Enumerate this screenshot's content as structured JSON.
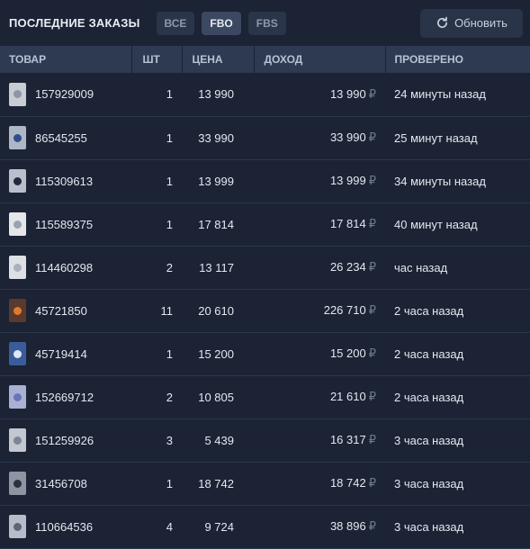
{
  "header": {
    "title": "ПОСЛЕДНИЕ ЗАКАЗЫ",
    "filters": [
      {
        "label": "ВСЕ",
        "active": false
      },
      {
        "label": "FBO",
        "active": true
      },
      {
        "label": "FBS",
        "active": false
      }
    ],
    "refresh_label": "Обновить",
    "refresh_icon": "refresh-icon"
  },
  "table": {
    "columns": [
      "ТОВАР",
      "ШТ",
      "ЦЕНА",
      "ДОХОД",
      "ПРОВЕРЕНО"
    ],
    "currency_symbol": "₽",
    "rows": [
      {
        "sku": "157929009",
        "qty": "1",
        "price": "13 990",
        "income": "13 990",
        "checked": "24 минуты назад",
        "thumb": {
          "bg": "#c9ccd3",
          "accent": "#8e96a4"
        }
      },
      {
        "sku": "86545255",
        "qty": "1",
        "price": "33 990",
        "income": "33 990",
        "checked": "25 минут назад",
        "thumb": {
          "bg": "#aeb7c6",
          "accent": "#2e4f8c"
        }
      },
      {
        "sku": "115309613",
        "qty": "1",
        "price": "13 999",
        "income": "13 999",
        "checked": "34 минуты назад",
        "thumb": {
          "bg": "#b9c0cb",
          "accent": "#1e2a40"
        }
      },
      {
        "sku": "115589375",
        "qty": "1",
        "price": "17 814",
        "income": "17 814",
        "checked": "40 минут назад",
        "thumb": {
          "bg": "#e4e6ea",
          "accent": "#9aa3b0"
        }
      },
      {
        "sku": "114460298",
        "qty": "2",
        "price": "13 117",
        "income": "26 234",
        "checked": "час назад",
        "thumb": {
          "bg": "#dde0e5",
          "accent": "#a9b1bd"
        }
      },
      {
        "sku": "45721850",
        "qty": "11",
        "price": "20 610",
        "income": "226 710",
        "checked": "2 часа назад",
        "thumb": {
          "bg": "#5a3a2c",
          "accent": "#e07a2e"
        }
      },
      {
        "sku": "45719414",
        "qty": "1",
        "price": "15 200",
        "income": "15 200",
        "checked": "2 часа назад",
        "thumb": {
          "bg": "#3a5c9a",
          "accent": "#dfe8f5"
        }
      },
      {
        "sku": "152669712",
        "qty": "2",
        "price": "10 805",
        "income": "21 610",
        "checked": "2 часа назад",
        "thumb": {
          "bg": "#aab0d4",
          "accent": "#6a74b8"
        }
      },
      {
        "sku": "151259926",
        "qty": "3",
        "price": "5 439",
        "income": "16 317",
        "checked": "3 часа назад",
        "thumb": {
          "bg": "#c3c8d0",
          "accent": "#7b8596"
        }
      },
      {
        "sku": "31456708",
        "qty": "1",
        "price": "18 742",
        "income": "18 742",
        "checked": "3 часа назад",
        "thumb": {
          "bg": "#8d95a3",
          "accent": "#2a3140"
        }
      },
      {
        "sku": "110664536",
        "qty": "4",
        "price": "9 724",
        "income": "38 896",
        "checked": "3 часа назад",
        "thumb": {
          "bg": "#b7bdc8",
          "accent": "#5c6678"
        }
      }
    ]
  }
}
